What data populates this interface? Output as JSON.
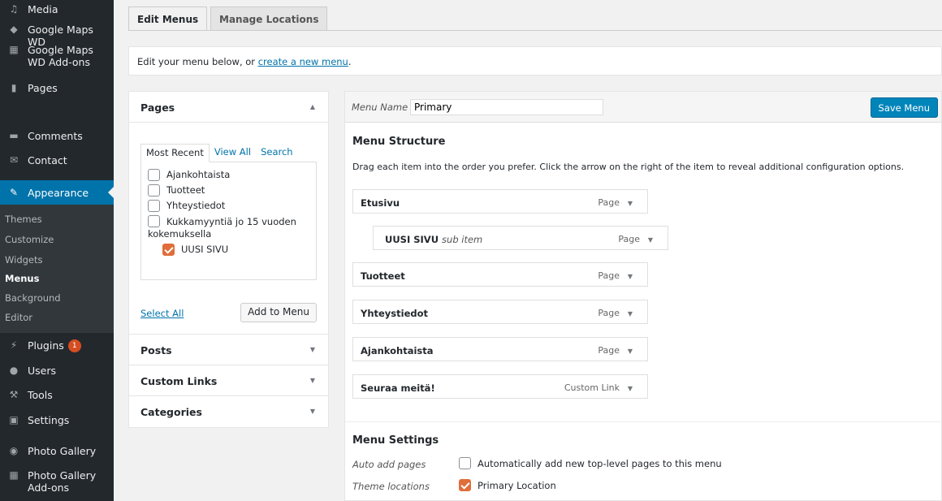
{
  "sidebar": {
    "items": [
      {
        "label": "Media",
        "icon": "media-icon"
      },
      {
        "label": "Google Maps WD",
        "icon": "map-icon"
      },
      {
        "label": "Google Maps WD Add-ons",
        "icon": "addon-icon"
      },
      {
        "label": "Pages",
        "icon": "pages-icon"
      },
      {
        "label": "Comments",
        "icon": "comments-icon"
      },
      {
        "label": "Contact",
        "icon": "mail-icon"
      },
      {
        "label": "Appearance",
        "icon": "brush-icon"
      },
      {
        "label": "Plugins",
        "icon": "plugin-icon",
        "badge": "1"
      },
      {
        "label": "Users",
        "icon": "users-icon"
      },
      {
        "label": "Tools",
        "icon": "wrench-icon"
      },
      {
        "label": "Settings",
        "icon": "settings-icon"
      },
      {
        "label": "Photo Gallery",
        "icon": "camera-icon"
      },
      {
        "label": "Photo Gallery Add-ons",
        "icon": "addon-icon"
      }
    ],
    "submenu": [
      "Themes",
      "Customize",
      "Widgets",
      "Menus",
      "Background",
      "Editor"
    ]
  },
  "tabs": [
    "Edit Menus",
    "Manage Locations"
  ],
  "notice": {
    "text": "Edit your menu below, or ",
    "link": "create a new menu",
    "suffix": "."
  },
  "accordion": {
    "pages_title": "Pages",
    "subtabs": [
      "Most Recent",
      "View All",
      "Search"
    ],
    "pages": [
      {
        "label": "Ajankohtaista",
        "checked": false
      },
      {
        "label": "Tuotteet",
        "checked": false
      },
      {
        "label": "Yhteystiedot",
        "checked": false
      },
      {
        "label": "Kukkamyyntiä jo 15 vuoden kokemuksella",
        "checked": false
      },
      {
        "label": "UUSI SIVU",
        "checked": true
      }
    ],
    "select_all": "Select All",
    "add_to_menu": "Add to Menu",
    "sections": [
      "Posts",
      "Custom Links",
      "Categories"
    ]
  },
  "editor": {
    "menu_name_label": "Menu Name",
    "menu_name_value": "Primary",
    "save_label": "Save Menu",
    "structure_title": "Menu Structure",
    "instructions": "Drag each item into the order you prefer. Click the arrow on the right of the item to reveal additional configuration options.",
    "items": [
      {
        "title": "Etusivu",
        "type": "Page",
        "sub": ""
      },
      {
        "title": "UUSI SIVU",
        "type": "Page",
        "sub": "sub item"
      },
      {
        "title": "Tuotteet",
        "type": "Page",
        "sub": ""
      },
      {
        "title": "Yhteystiedot",
        "type": "Page",
        "sub": ""
      },
      {
        "title": "Ajankohtaista",
        "type": "Page",
        "sub": ""
      },
      {
        "title": "Seuraa meitä!",
        "type": "Custom Link",
        "sub": ""
      }
    ],
    "settings_title": "Menu Settings",
    "auto_add_label": "Auto add pages",
    "auto_add_text": "Automatically add new top-level pages to this menu",
    "auto_add_checked": false,
    "locations_label": "Theme locations",
    "primary_location_text": "Primary Location",
    "primary_location_checked": true
  },
  "colors": {
    "accent": "#0073aa",
    "sidebar": "#23282d",
    "checkbox_checked": "#e06d3a",
    "badge": "#d54e21"
  }
}
